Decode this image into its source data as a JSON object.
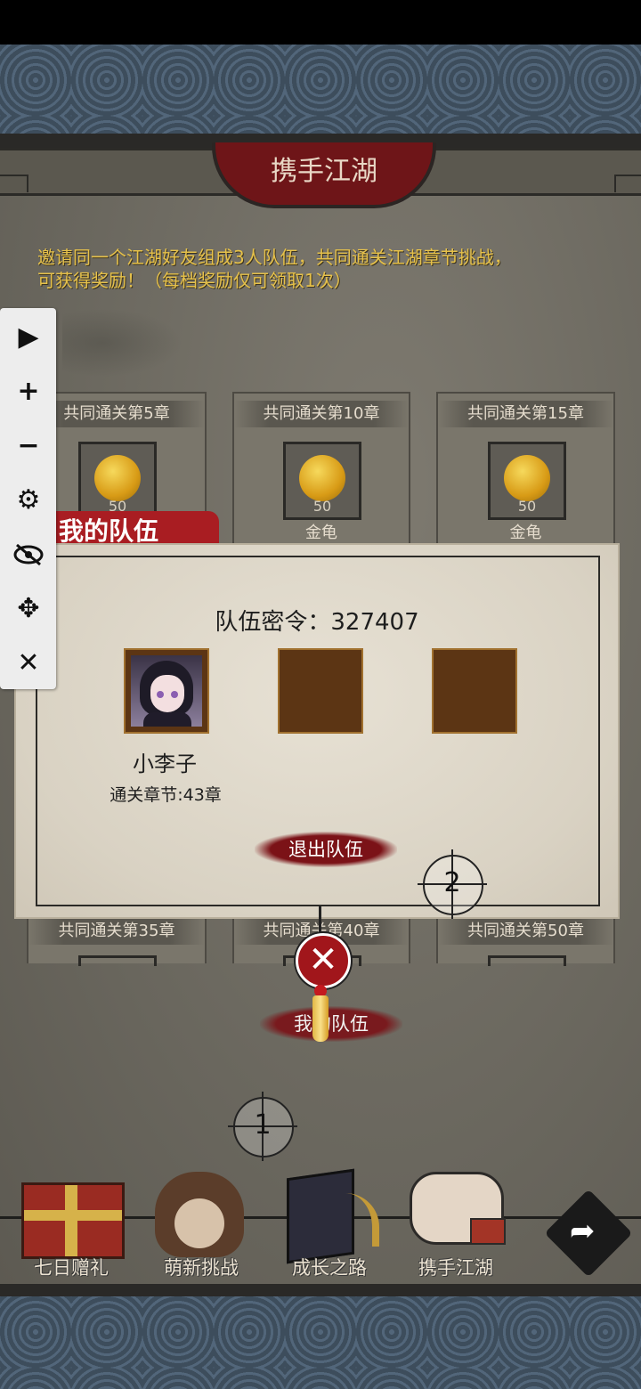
{
  "header": {
    "title": "携手江湖"
  },
  "intro": {
    "line1": "邀请同一个江湖好友组成3人队伍，共同通关江湖章节挑战，",
    "line2": "可获得奖励！（每档奖励仅可领取1次）"
  },
  "rewards_top": [
    {
      "title": "共同通关第5章",
      "qty": "50",
      "name": "金龟"
    },
    {
      "title": "共同通关第10章",
      "qty": "50",
      "name": "金龟"
    },
    {
      "title": "共同通关第15章",
      "qty": "50",
      "name": "金龟"
    }
  ],
  "rewards_bottom": [
    {
      "title": "共同通关第35章"
    },
    {
      "title": "共同通关第40章"
    },
    {
      "title": "共同通关第50章"
    }
  ],
  "dialog": {
    "tab": "我的队伍",
    "team_code_label": "队伍密令：",
    "team_code": "327407",
    "member": {
      "name": "小李子",
      "progress": "通关章节:43章"
    },
    "leave_button": "退出队伍"
  },
  "below_dialog_button": "我的队伍",
  "toolbar": [
    "play-icon",
    "plus-icon",
    "minus-icon",
    "gear-icon",
    "eye-off-icon",
    "move-icon",
    "close-icon"
  ],
  "markers": {
    "m1": "1",
    "m2": "2"
  },
  "nav": [
    {
      "label": "七日赠礼",
      "icon": "gift-icon"
    },
    {
      "label": "萌新挑战",
      "icon": "character-icon"
    },
    {
      "label": "成长之路",
      "icon": "book-icon"
    },
    {
      "label": "携手江湖",
      "icon": "handshake-icon"
    }
  ],
  "colors": {
    "accent_red": "#a91d22",
    "gold_text": "#e6c14a",
    "dark_red": "#6e1518"
  }
}
